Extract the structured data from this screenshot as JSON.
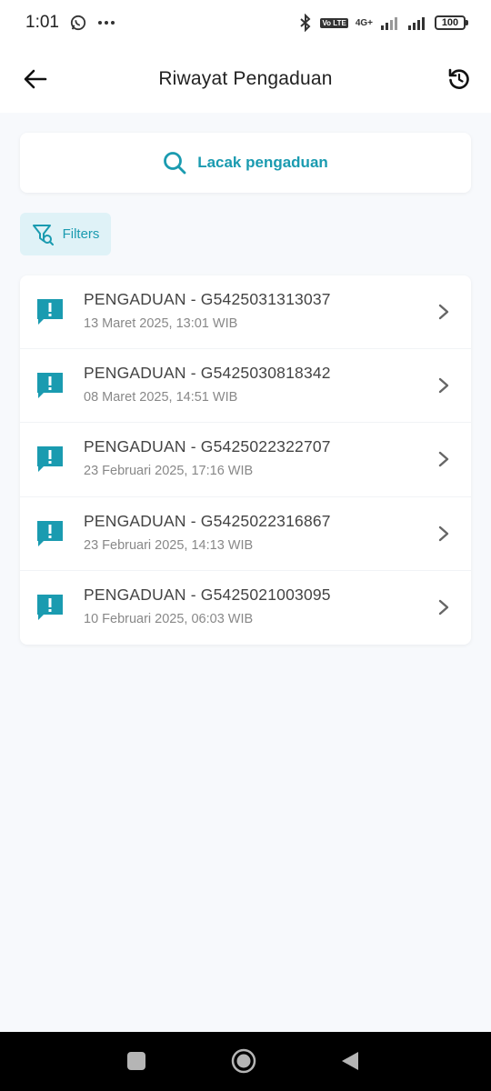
{
  "status_bar": {
    "time": "1:01",
    "lte_badge": "Vo LTE",
    "network": "4G+",
    "battery": "100"
  },
  "header": {
    "title": "Riwayat Pengaduan"
  },
  "search": {
    "label": "Lacak pengaduan"
  },
  "filter": {
    "label": "Filters"
  },
  "complaints": [
    {
      "title": "PENGADUAN - G5425031313037",
      "date": "13 Maret 2025, 13:01 WIB"
    },
    {
      "title": "PENGADUAN - G5425030818342",
      "date": "08 Maret 2025, 14:51 WIB"
    },
    {
      "title": "PENGADUAN - G5425022322707",
      "date": "23 Februari 2025, 17:16 WIB"
    },
    {
      "title": "PENGADUAN - G5425022316867",
      "date": "23 Februari 2025, 14:13 WIB"
    },
    {
      "title": "PENGADUAN - G5425021003095",
      "date": "10 Februari 2025, 06:03 WIB"
    }
  ],
  "colors": {
    "accent": "#1a9bb0",
    "filter_bg": "#dff2f7",
    "background": "#f7f9fc"
  },
  "icons": {
    "back": "arrow-left-icon",
    "refresh": "refresh-icon",
    "search": "search-icon",
    "filter": "filter-icon",
    "complaint": "alert-message-icon",
    "chevron": "chevron-right-icon"
  }
}
